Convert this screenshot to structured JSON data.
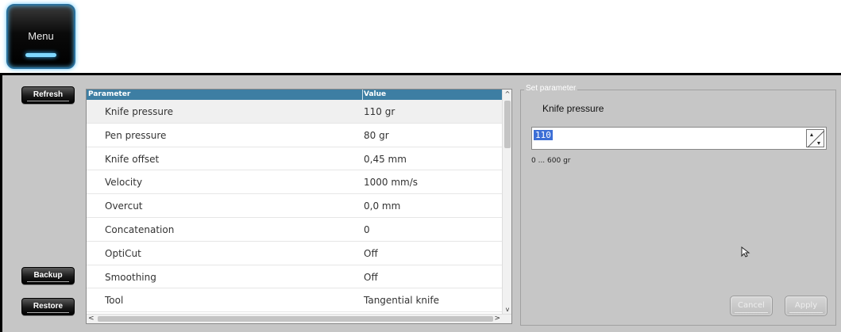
{
  "menu": {
    "label": "Menu"
  },
  "sidebar": {
    "refresh": "Refresh",
    "backup": "Backup",
    "restore": "Restore"
  },
  "table": {
    "columns": [
      "Parameter",
      "Value"
    ],
    "rows": [
      {
        "parameter": "Knife pressure",
        "value": "110 gr"
      },
      {
        "parameter": "Pen pressure",
        "value": "80 gr"
      },
      {
        "parameter": "Knife offset",
        "value": "0,45 mm"
      },
      {
        "parameter": "Velocity",
        "value": "1000 mm/s"
      },
      {
        "parameter": "Overcut",
        "value": "0,0 mm"
      },
      {
        "parameter": "Concatenation",
        "value": "0"
      },
      {
        "parameter": "OptiCut",
        "value": "Off"
      },
      {
        "parameter": "Smoothing",
        "value": "Off"
      },
      {
        "parameter": "Tool",
        "value": "Tangential knife"
      }
    ],
    "scroll_up": "^",
    "scroll_down": "v",
    "scroll_left": "<",
    "scroll_right": ">"
  },
  "set_parameter": {
    "legend": "Set parameter",
    "name": "Knife pressure",
    "value": "110",
    "range": "0 ... 600 gr",
    "cancel": "Cancel",
    "apply": "Apply"
  },
  "icons": {
    "spinner": "spin-updown-icon",
    "cursor": "mouse-cursor-icon"
  },
  "colors": {
    "header": "#3d7ea3",
    "panel": "#c6c6c6",
    "selection": "#3d6fd6",
    "menu_glow": "#5fc7ff"
  }
}
